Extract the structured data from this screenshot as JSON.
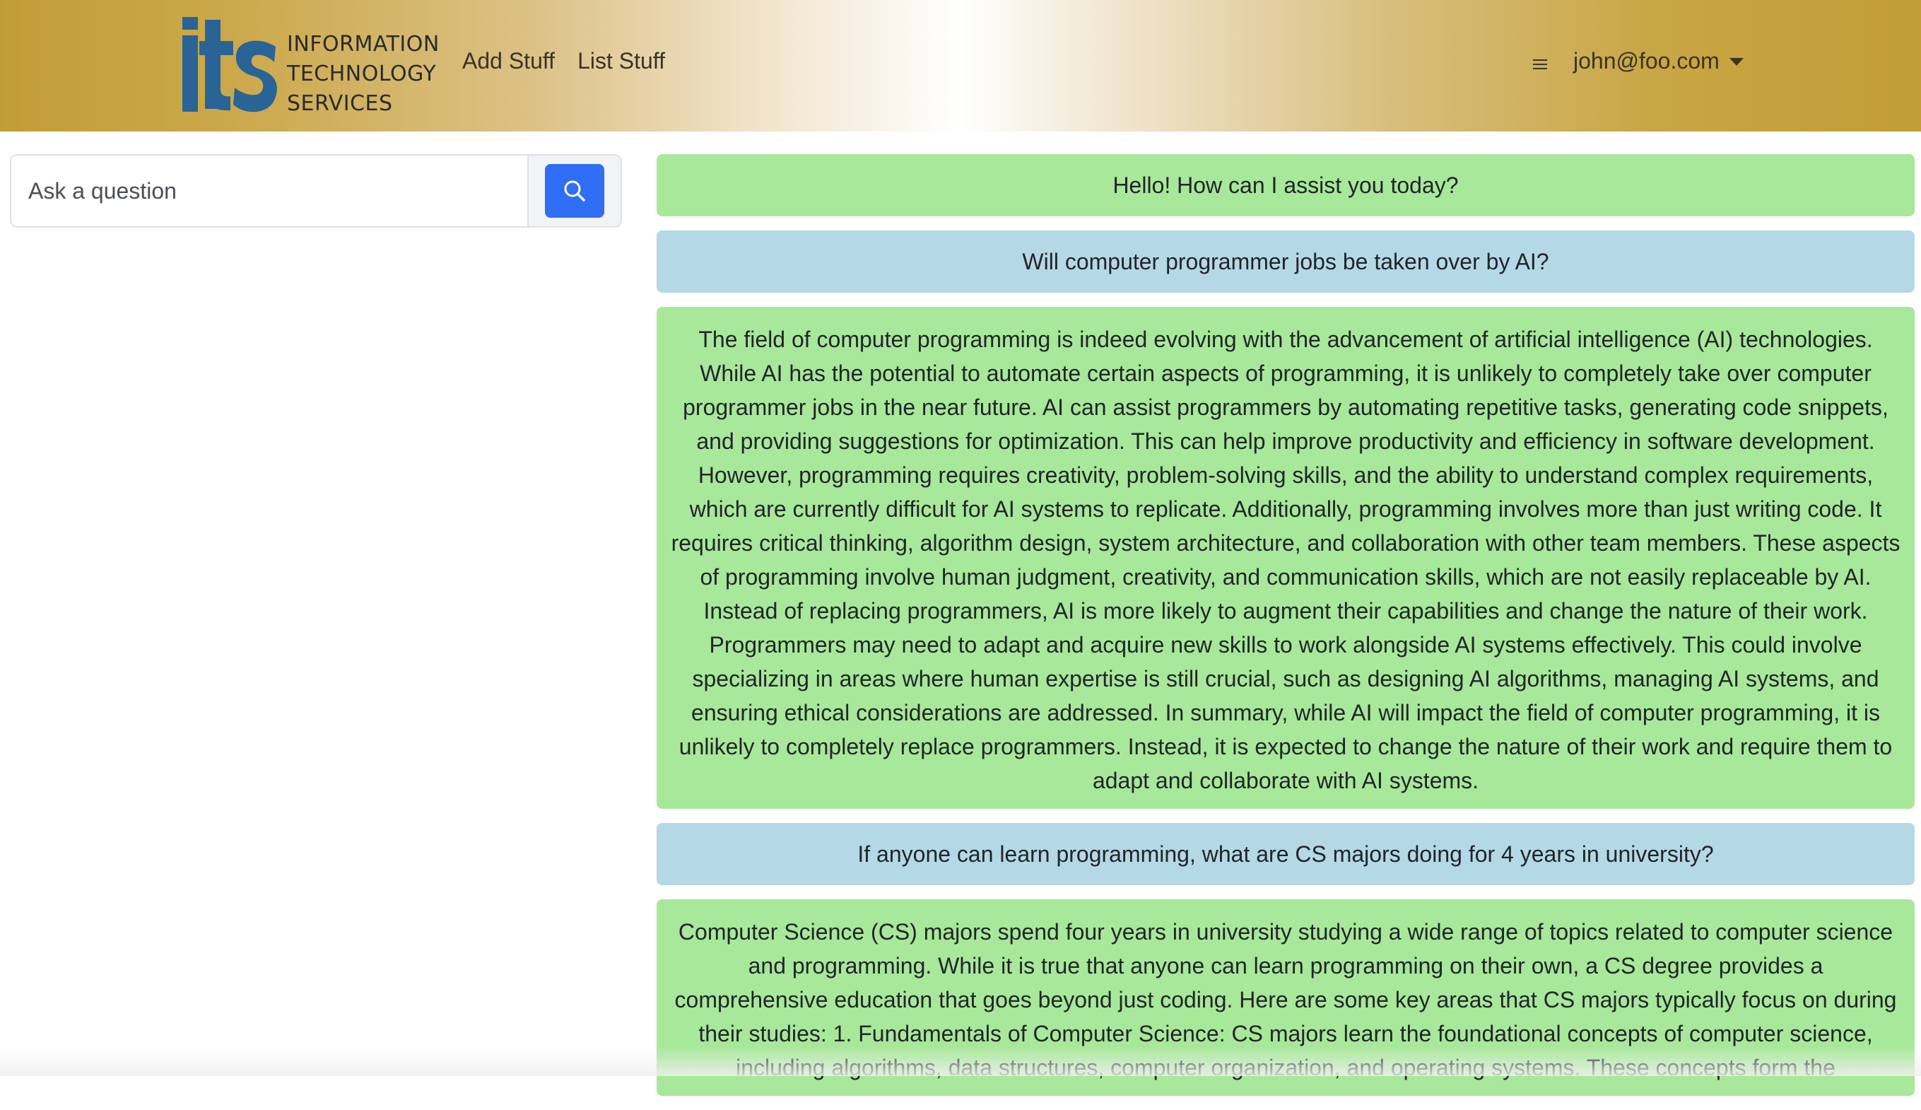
{
  "brand": {
    "logo_mark": "its",
    "logo_lines": [
      "INFORMATION",
      "TECHNOLOGY",
      "SERVICES"
    ]
  },
  "nav": {
    "links": [
      "Add Stuff",
      "List Stuff"
    ],
    "menu_icon": "hamburger-icon",
    "user_email": "john@foo.com"
  },
  "search": {
    "placeholder": "Ask a question",
    "value": "",
    "button_icon": "search-icon"
  },
  "messages": [
    {
      "role": "assistant",
      "text": "Hello! How can I assist you today?"
    },
    {
      "role": "user",
      "text": "Will computer programmer jobs be taken over by AI?"
    },
    {
      "role": "assistant",
      "text": "The field of computer programming is indeed evolving with the advancement of artificial intelligence (AI) technologies. While AI has the potential to automate certain aspects of programming, it is unlikely to completely take over computer programmer jobs in the near future. AI can assist programmers by automating repetitive tasks, generating code snippets, and providing suggestions for optimization. This can help improve productivity and efficiency in software development. However, programming requires creativity, problem-solving skills, and the ability to understand complex requirements, which are currently difficult for AI systems to replicate. Additionally, programming involves more than just writing code. It requires critical thinking, algorithm design, system architecture, and collaboration with other team members. These aspects of programming involve human judgment, creativity, and communication skills, which are not easily replaceable by AI. Instead of replacing programmers, AI is more likely to augment their capabilities and change the nature of their work. Programmers may need to adapt and acquire new skills to work alongside AI systems effectively. This could involve specializing in areas where human expertise is still crucial, such as designing AI algorithms, managing AI systems, and ensuring ethical considerations are addressed. In summary, while AI will impact the field of computer programming, it is unlikely to completely replace programmers. Instead, it is expected to change the nature of their work and require them to adapt and collaborate with AI systems."
    },
    {
      "role": "user",
      "text": "If anyone can learn programming, what are CS majors doing for 4 years in university?"
    },
    {
      "role": "assistant",
      "text": "Computer Science (CS) majors spend four years in university studying a wide range of topics related to computer science and programming. While it is true that anyone can learn programming on their own, a CS degree provides a comprehensive education that goes beyond just coding. Here are some key areas that CS majors typically focus on during their studies: 1. Fundamentals of Computer Science: CS majors learn the foundational concepts of computer science, including algorithms, data structures, computer organization, and operating systems. These concepts form the"
    }
  ],
  "colors": {
    "assistant_bubble": "#a8e89a",
    "user_bubble": "#b5d8e6",
    "search_button": "#2f6ef5",
    "logo_blue": "#2a6496"
  }
}
